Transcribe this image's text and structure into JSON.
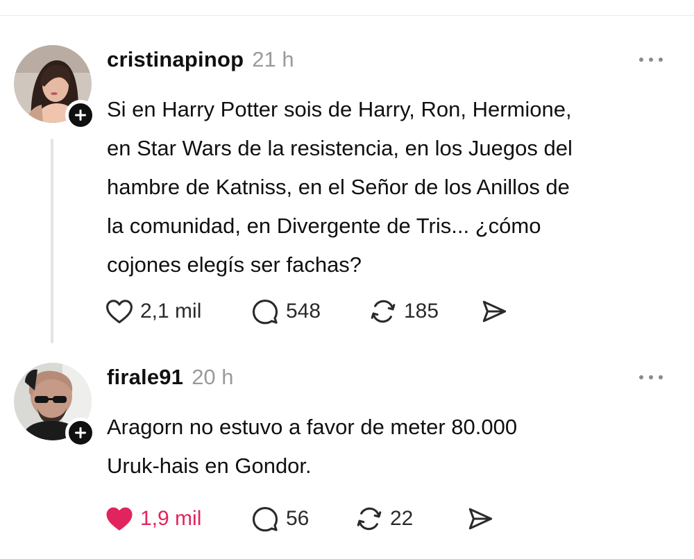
{
  "posts": [
    {
      "username": "cristinapinop",
      "time": "21 h",
      "text_lines": [
        "Si en Harry Potter sois de Harry, Ron, Hermione,",
        "en Star Wars de la resistencia, en los Juegos del",
        "hambre de Katniss, en el Señor de los Anillos de",
        "la comunidad, en Divergente de Tris... ¿cómo",
        "cojones elegís ser fachas?"
      ],
      "likes": "2,1 mil",
      "liked": false,
      "replies": "548",
      "reposts": "185"
    },
    {
      "username": "firale91",
      "time": "20 h",
      "text_lines": [
        "Aragorn no estuvo a favor de meter 80.000",
        "Uruk-hais en Gondor."
      ],
      "likes": "1,9 mil",
      "liked": true,
      "replies": "56",
      "reposts": "22"
    }
  ],
  "icons": {
    "like": "heart-icon",
    "reply": "comment-bubble-icon",
    "repost": "repost-arrows-icon",
    "share": "send-icon",
    "more": "more-dots-icon",
    "follow": "plus-icon"
  },
  "colors": {
    "text": "#101010",
    "muted": "#9a9a9a",
    "liked": "#e0245e",
    "thread_line": "#e3e3e3"
  }
}
